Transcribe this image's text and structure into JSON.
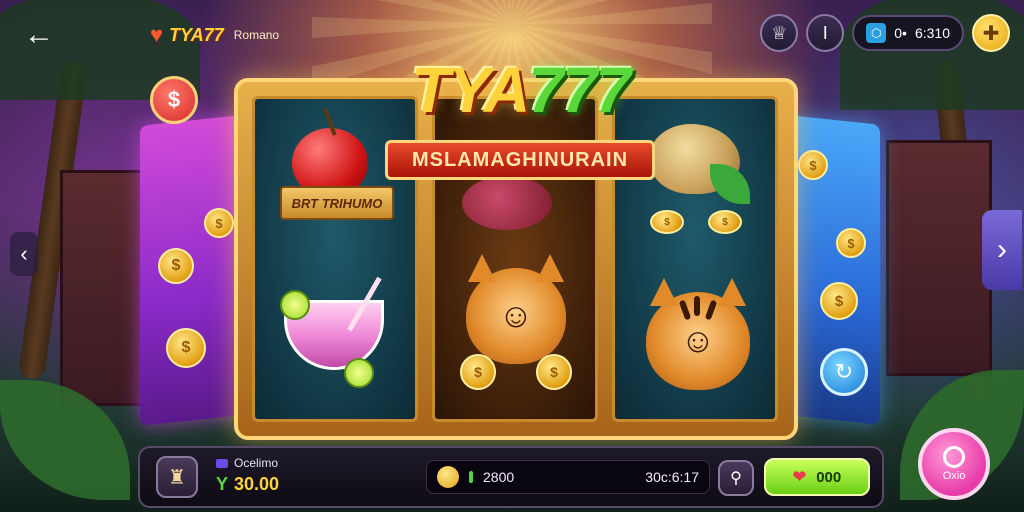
{
  "top_bar": {
    "back_icon": "arrow-left-icon",
    "brand_mark": "♥",
    "brand_name": "TYA77",
    "brand_sub": "Romano",
    "btn1_icon": "trophy-icon",
    "btn2_icon": "info-icon",
    "pill_tag": "⬡",
    "pill_arrow": "0•",
    "balance": "6:310",
    "add_button_icon": "plus-coin-icon"
  },
  "game": {
    "title_part1": "TYA",
    "title_part2": "777",
    "banner": "MSLAMAGHINURAIN",
    "ribbon_text": "BRT TRIHUMO",
    "left_coin_symbol": "$",
    "left_nav_arrow": "‹",
    "right_nav_arrow": "›",
    "refresh_icon": "refresh-icon",
    "reels": [
      {
        "top": "cherry",
        "bottom": "cocktail"
      },
      {
        "top": "leaf-fruit",
        "bottom": "cat"
      },
      {
        "top": "potato",
        "bottom": "tiger"
      }
    ]
  },
  "bottom_bar": {
    "bag_icon": "bag-icon",
    "account_label": "Ocelimo",
    "currency_prefix": "Y",
    "account_balance": "30.00",
    "win_value": "2800",
    "win_right_text": "30c:6:17",
    "search_icon": "search-icon",
    "bet_value": "000",
    "spin_label": "Oxio"
  },
  "colors": {
    "gold": "#ffd23c",
    "green": "#5ad83a",
    "pink": "#e83aa8",
    "frame": "#e8b04a"
  }
}
